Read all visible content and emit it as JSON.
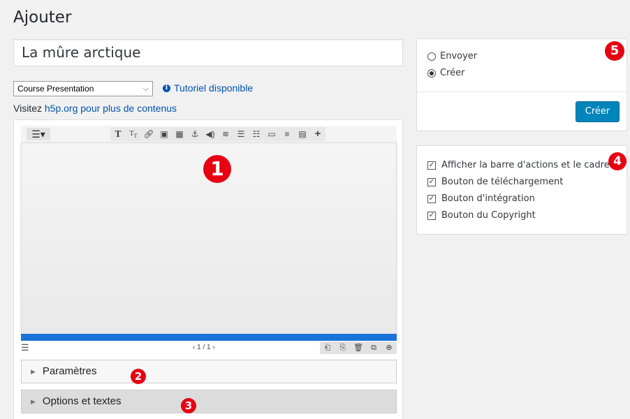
{
  "page": {
    "title": "Ajouter"
  },
  "post_title": "La mûre arctique",
  "content_type": {
    "selected": "Course Presentation"
  },
  "tutorial_link": "Tutoriel disponible",
  "visit": {
    "prefix": "Visitez ",
    "link": "h5p.org pour plus de contenus"
  },
  "editor": {
    "toolbar_icons": [
      "text-icon",
      "go-to-slide-icon",
      "link-icon",
      "image-icon",
      "video-icon",
      "anchor-icon",
      "audio-icon",
      "summary-icon",
      "single-choice-icon",
      "multiple-choice-icon",
      "dialog-cards-icon",
      "table-icon",
      "fill-blanks-icon",
      "more-icon"
    ],
    "pager": "‹ 1 / 1 ›"
  },
  "sections": {
    "params": "Paramètres",
    "options": "Options et textes"
  },
  "publish": {
    "radio_send": "Envoyer",
    "radio_create": "Créer",
    "selected": "Créer",
    "button": "Créer"
  },
  "display_options": {
    "items": [
      {
        "label": "Afficher la barre d'actions et le cadre",
        "checked": true
      },
      {
        "label": "Bouton de téléchargement",
        "checked": true
      },
      {
        "label": "Bouton d'intégration",
        "checked": true
      },
      {
        "label": "Bouton du Copyright",
        "checked": true
      }
    ]
  },
  "callouts": [
    "1",
    "2",
    "3",
    "4",
    "5"
  ],
  "colors": {
    "accent": "#0085ba",
    "callout": "#e60012",
    "progress": "#1a73d9"
  }
}
